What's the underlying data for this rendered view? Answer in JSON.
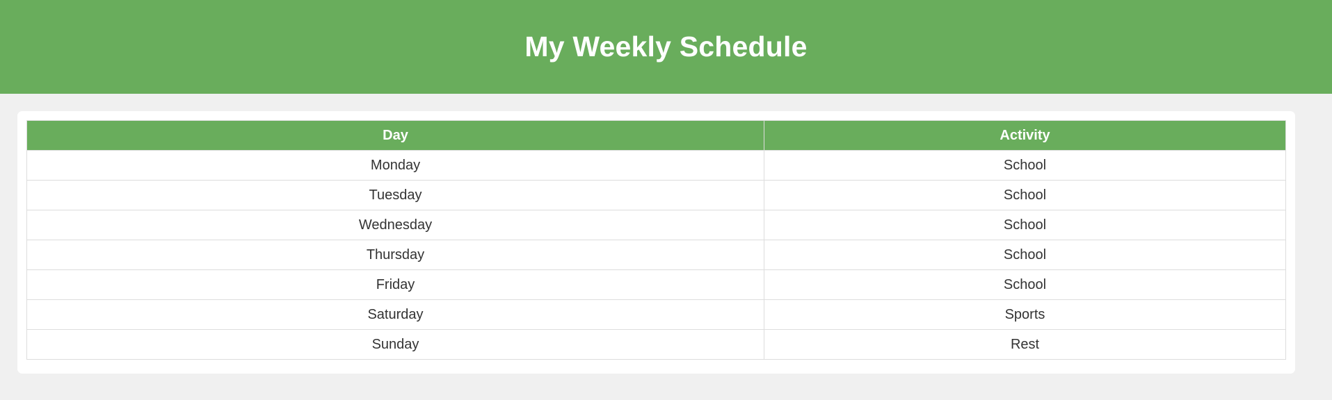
{
  "header": {
    "title": "My Weekly Schedule"
  },
  "colors": {
    "accent": "#69ad5c",
    "background": "#f0f0f0",
    "card": "#ffffff",
    "text": "#333333"
  },
  "table": {
    "columns": [
      "Day",
      "Activity"
    ],
    "rows": [
      {
        "day": "Monday",
        "activity": "School"
      },
      {
        "day": "Tuesday",
        "activity": "School"
      },
      {
        "day": "Wednesday",
        "activity": "School"
      },
      {
        "day": "Thursday",
        "activity": "School"
      },
      {
        "day": "Friday",
        "activity": "School"
      },
      {
        "day": "Saturday",
        "activity": "Sports"
      },
      {
        "day": "Sunday",
        "activity": "Rest"
      }
    ]
  }
}
